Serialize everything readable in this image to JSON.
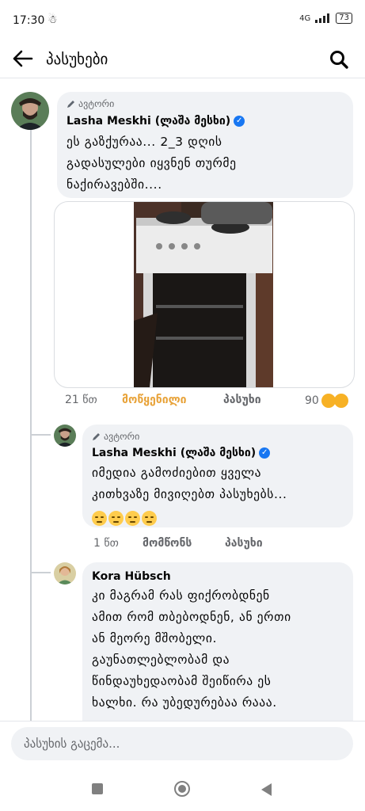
{
  "status_bar": {
    "time": "17:30",
    "network": "4G",
    "battery": "73"
  },
  "header": {
    "title": "პასუხები"
  },
  "comments": [
    {
      "badge": "ავტორი",
      "author": "Lasha Meskhi (ლაშა მესხი)",
      "text_lines": [
        "ეს გაზქურაა... 2_3 დღის",
        "გადასულები იყვნენ თურმე",
        "ნაქირავებში...."
      ],
      "time": "21 წთ",
      "like_label": "მოწყენილი",
      "reply_label": "პასუხი",
      "reactions_count": "90"
    },
    {
      "badge": "ავტორი",
      "author": "Lasha Meskhi (ლაშა მესხი)",
      "text_lines": [
        "იმედია გამოძიებით ყველა",
        "კითხვაზე მივიღებთ პასუხებს..."
      ],
      "time": "1 წთ",
      "like_label": "მომწონს",
      "reply_label": "პასუხი"
    },
    {
      "author": "Kora Hübsch",
      "text_lines": [
        "კი მაგრამ რას ფიქრობდნენ",
        "ამით რომ თბებოდნენ, ან ერთი",
        "ან მეორე მშობელი.",
        "გაუნათლებლობამ და",
        "წინდაუხედაობამ შეიწირა ეს",
        "ხალხი. რა უბედურებაა რააა."
      ]
    }
  ],
  "composer": {
    "placeholder": "პასუხის გაცემა..."
  },
  "colors": {
    "accent": "#1877f2",
    "sad_reaction": "#e8a33a",
    "bubble": "#f0f2f5"
  }
}
